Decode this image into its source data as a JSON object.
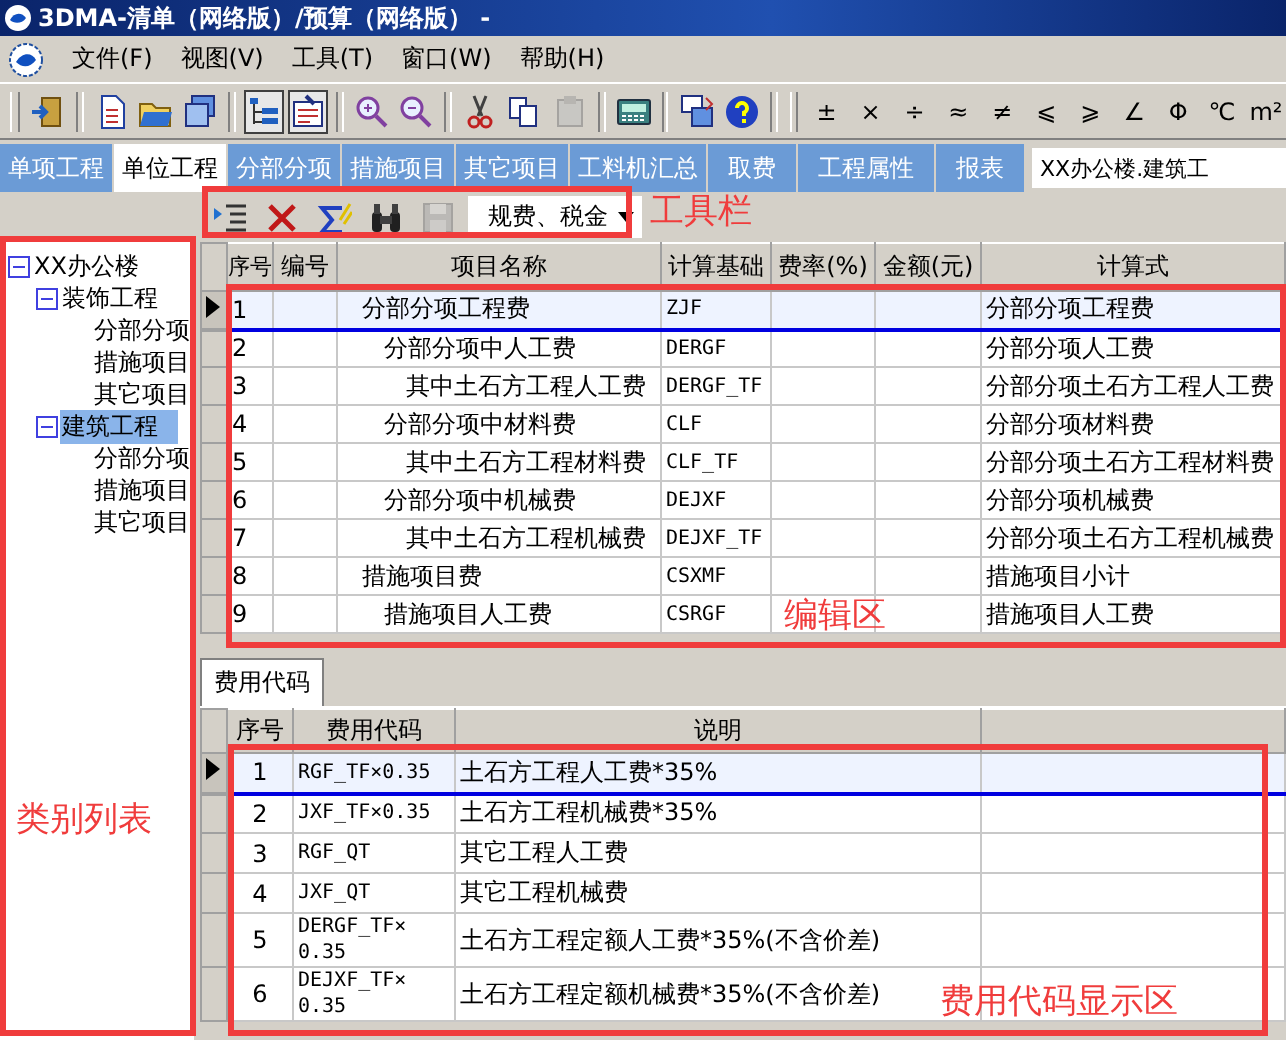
{
  "window": {
    "title": "3DMA-清单（网络版）/预算（网络版） -"
  },
  "menu": [
    "文件(F)",
    "视图(V)",
    "工具(T)",
    "窗口(W)",
    "帮助(H)"
  ],
  "toolbar": {
    "tools": [
      {
        "kind": "exit",
        "pressed": false,
        "disabled": false
      },
      {
        "kind": "new",
        "pressed": false,
        "disabled": false
      },
      {
        "kind": "open",
        "pressed": false,
        "disabled": false
      },
      {
        "kind": "windows",
        "pressed": false,
        "disabled": false
      },
      {
        "kind": "tree",
        "pressed": true,
        "disabled": false
      },
      {
        "kind": "form",
        "pressed": true,
        "disabled": false
      },
      {
        "kind": "zoomin",
        "pressed": false,
        "disabled": false
      },
      {
        "kind": "zoomout",
        "pressed": false,
        "disabled": false
      },
      {
        "kind": "cut",
        "pressed": false,
        "disabled": false
      },
      {
        "kind": "copy",
        "pressed": false,
        "disabled": false
      },
      {
        "kind": "paste",
        "pressed": false,
        "disabled": true
      },
      {
        "kind": "calc",
        "pressed": false,
        "disabled": false
      },
      {
        "kind": "cascade",
        "pressed": false,
        "disabled": false
      },
      {
        "kind": "help",
        "pressed": false,
        "disabled": false
      }
    ],
    "symbols": [
      "±",
      "×",
      "÷",
      "≈",
      "≠",
      "⩽",
      "⩾",
      "∠",
      "Φ",
      "℃",
      "m²"
    ]
  },
  "tabs": [
    {
      "label": "单项工程",
      "selected": false
    },
    {
      "label": "单位工程",
      "selected": true
    },
    {
      "label": "分部分项",
      "selected": false
    },
    {
      "label": "措施项目",
      "selected": false
    },
    {
      "label": "其它项目",
      "selected": false
    },
    {
      "label": "工料机汇总",
      "selected": false
    },
    {
      "label": "取费",
      "selected": false
    },
    {
      "label": "工程属性",
      "selected": false
    },
    {
      "label": "报表",
      "selected": false
    }
  ],
  "project_field": {
    "value": "XX办公楼.建筑工"
  },
  "edit_toolbar": {
    "tools": [
      {
        "kind": "insert",
        "disabled": false
      },
      {
        "kind": "delete",
        "disabled": false
      },
      {
        "kind": "sigma",
        "disabled": false
      },
      {
        "kind": "find",
        "disabled": false
      },
      {
        "kind": "save",
        "disabled": true
      }
    ],
    "dropdown": {
      "value": "规费、税金"
    }
  },
  "category_tree": [
    {
      "label": "XX办公楼",
      "expanded": true,
      "selected": false,
      "children": [
        {
          "label": "装饰工程",
          "expanded": true,
          "selected": false,
          "children": [
            {
              "label": "分部分项",
              "selected": false
            },
            {
              "label": "措施项目",
              "selected": false
            },
            {
              "label": "其它项目",
              "selected": false
            }
          ]
        },
        {
          "label": "建筑工程",
          "expanded": true,
          "selected": true,
          "children": [
            {
              "label": "分部分项",
              "selected": false
            },
            {
              "label": "措施项目",
              "selected": false
            },
            {
              "label": "其它项目",
              "selected": false
            }
          ]
        }
      ]
    }
  ],
  "fee_table": {
    "columns": [
      "序号",
      "编号",
      "项目名称",
      "计算基础",
      "费率(%)",
      "金额(元)",
      "计算式"
    ],
    "rows": [
      {
        "no": "1",
        "name": "分部分项工程费",
        "basis": "ZJF",
        "formula": "分部分项工程费",
        "selected": true,
        "children": [
          {
            "no": "2",
            "name": "分部分项中人工费",
            "basis": "DERGF",
            "formula": "分部分项人工费",
            "selected": false,
            "children": [
              {
                "no": "3",
                "name": "其中土石方工程人工费",
                "basis": "DERGF_TF",
                "formula": "分部分项土石方工程人工费",
                "selected": false
              }
            ]
          },
          {
            "no": "4",
            "name": "分部分项中材料费",
            "basis": "CLF",
            "formula": "分部分项材料费",
            "selected": false,
            "children": [
              {
                "no": "5",
                "name": "其中土石方工程材料费",
                "basis": "CLF_TF",
                "formula": "分部分项土石方工程材料费",
                "selected": false
              }
            ]
          },
          {
            "no": "6",
            "name": "分部分项中机械费",
            "basis": "DEJXF",
            "formula": "分部分项机械费",
            "selected": false,
            "children": [
              {
                "no": "7",
                "name": "其中土石方工程机械费",
                "basis": "DEJXF_TF",
                "formula": "分部分项土石方工程机械费",
                "selected": false
              }
            ]
          }
        ]
      },
      {
        "no": "8",
        "name": "措施项目费",
        "basis": "CSXMF",
        "formula": "措施项目小计",
        "selected": false,
        "children": [
          {
            "no": "9",
            "name": "措施项目人工费",
            "basis": "CSRGF",
            "formula": "措施项目人工费",
            "selected": false
          }
        ]
      }
    ]
  },
  "code_tabs": [
    {
      "label": "费用代码",
      "selected": true
    }
  ],
  "code_table": {
    "columns": [
      "序号",
      "费用代码",
      "说明"
    ],
    "rows": [
      {
        "no": "1",
        "code": "RGF_TF×0.35",
        "description": "土石方工程人工费*35%",
        "selected": true
      },
      {
        "no": "2",
        "code": "JXF_TF×0.35",
        "description": "土石方工程机械费*35%",
        "selected": false
      },
      {
        "no": "3",
        "code": "RGF_QT",
        "description": "其它工程人工费",
        "selected": false
      },
      {
        "no": "4",
        "code": "JXF_QT",
        "description": "其它工程机械费",
        "selected": false
      },
      {
        "no": "5",
        "code": "DERGF_TF× 0.35",
        "description": "土石方工程定额人工费*35%(不含价差)",
        "selected": false
      },
      {
        "no": "6",
        "code": "DEJXF_TF× 0.35",
        "description": "土石方工程定额机械费*35%(不含价差)",
        "selected": false
      }
    ]
  },
  "annotations": [
    {
      "label": "工具栏"
    },
    {
      "label": "编辑区"
    },
    {
      "label": "类别列表"
    },
    {
      "label": "费用代码显示区"
    }
  ]
}
